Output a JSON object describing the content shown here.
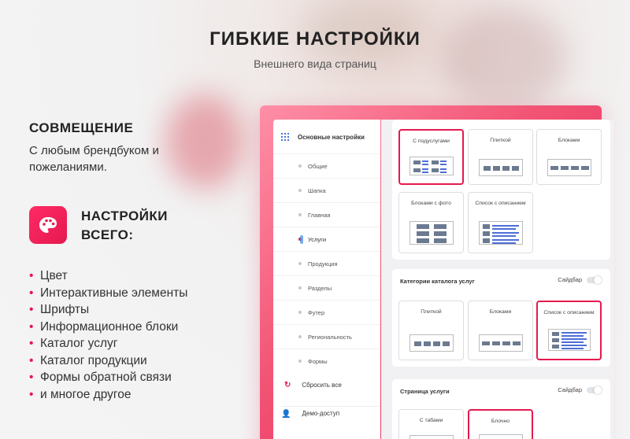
{
  "hero": {
    "title": "ГИБКИЕ НАСТРОЙКИ",
    "subtitle": "Внешнего вида страниц"
  },
  "feature": {
    "title": "СОВМЕЩЕНИЕ",
    "text": "С любым брендбуком и пожеланиями."
  },
  "settings": {
    "title_line1": "НАСТРОЙКИ",
    "title_line2": "ВСЕГО:",
    "icon": "palette-icon",
    "items": [
      "Цвет",
      "Интерактивные элементы",
      "Шрифты",
      "Информационное блоки",
      "Каталог услуг",
      "Каталог продукции",
      "Формы обратной связи",
      "и многое другое"
    ]
  },
  "sidebar": {
    "header": "Основные настройки",
    "items": [
      "Общие",
      "Шапка",
      "Главная",
      "Услуги",
      "Продукция",
      "Разделы",
      "Футер",
      "Региональность",
      "Формы"
    ],
    "active_index": 3,
    "reset": "Сбросить все",
    "demo": "Демо-доступ"
  },
  "content": {
    "services_layouts": [
      "С подуслугами",
      "Плиткой",
      "Блоками",
      "Блоками с фото",
      "Список с описанием"
    ],
    "catalog": {
      "title": "Категории каталога услуг",
      "switch_label": "Сайдбар",
      "layouts": [
        "Плиткой",
        "Блоками",
        "Список с описанием"
      ]
    },
    "service_page": {
      "title": "Страница услуги",
      "switch_label": "Сайдбар",
      "layouts": [
        "С табами",
        "Блочно"
      ]
    }
  },
  "colors": {
    "accent": "#e5194e",
    "link_blue": "#4c6fe0"
  }
}
